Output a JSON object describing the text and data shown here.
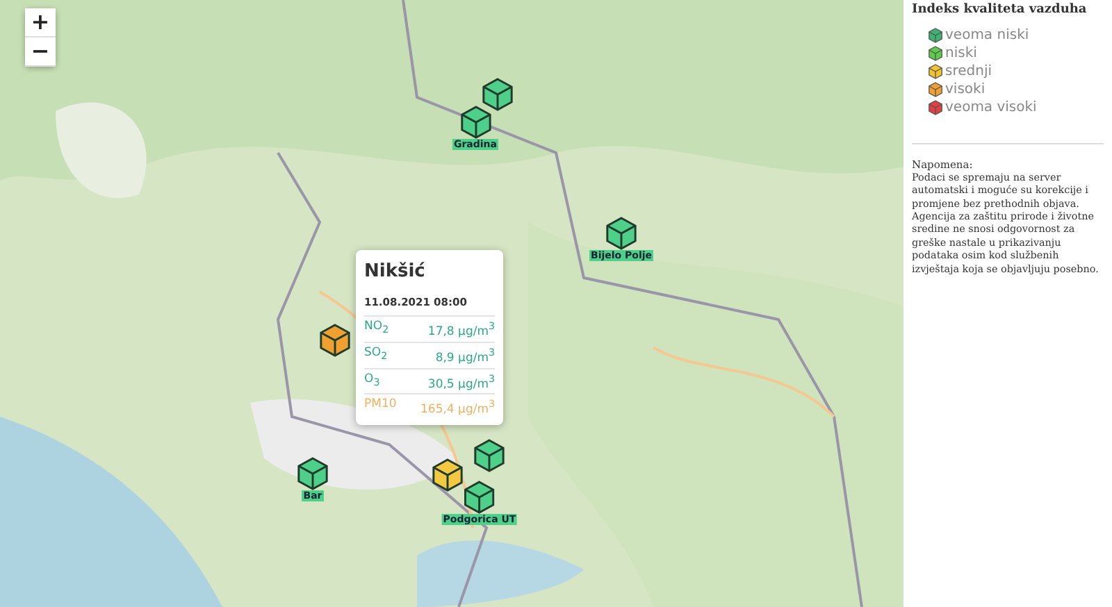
{
  "zoom_controls": [
    "+",
    "−"
  ],
  "markers": [
    {
      "color": "#4fd08a"
    },
    {
      "label": "Gradina",
      "color": "#4fd08a"
    },
    {
      "label": "Bijelo Polje",
      "color": "#4fd08a"
    },
    {
      "color": "#f0a030"
    },
    {
      "label": "Bar",
      "color": "#4fd08a"
    },
    {
      "color": "#4fd08a"
    },
    {
      "color": "#f5c842"
    },
    {
      "label": "Podgorica UT",
      "color": "#4fd08a"
    }
  ],
  "popup": {
    "title": "Nikšić",
    "datetime": "11.08.2021 08:00",
    "rows": [
      {
        "name": "NO$_{2}$",
        "value": "17,8 µg/m$^{3}$",
        "color": "#2aa889"
      },
      {
        "name": "SO$_{2}$",
        "value": "8,9 µg/m$^{3}$",
        "color": "#2aa889"
      },
      {
        "name": "O$_{3}$",
        "value": "30,5 µg/m$^{3}$",
        "color": "#2aa889"
      },
      {
        "name": "PM10",
        "value": "165,4 µg/m$^{3}$",
        "color": "#f0b060"
      }
    ]
  },
  "legend": {
    "title": "Indeks kvaliteta vazduha",
    "items": [
      {
        "label": "veoma niski",
        "color": "#3cb371"
      },
      {
        "label": "niski",
        "color": "#5ccc4a"
      },
      {
        "label": "srednji",
        "color": "#f2c230"
      },
      {
        "label": "visoki",
        "color": "#f0a030"
      },
      {
        "label": "veoma visoki",
        "color": "#e04040"
      }
    ]
  },
  "note": {
    "title": "Napomena:",
    "text": "Podaci se spremaju na server automatski i moguće su korekcije i promjene bez prethodnih objava. Agencija za zaštitu prirode i životne sredine ne snosi odgovornost za greške nastale u prikazivanju podataka osim kod službenih izvještaja koja se objavljuju posebno."
  }
}
